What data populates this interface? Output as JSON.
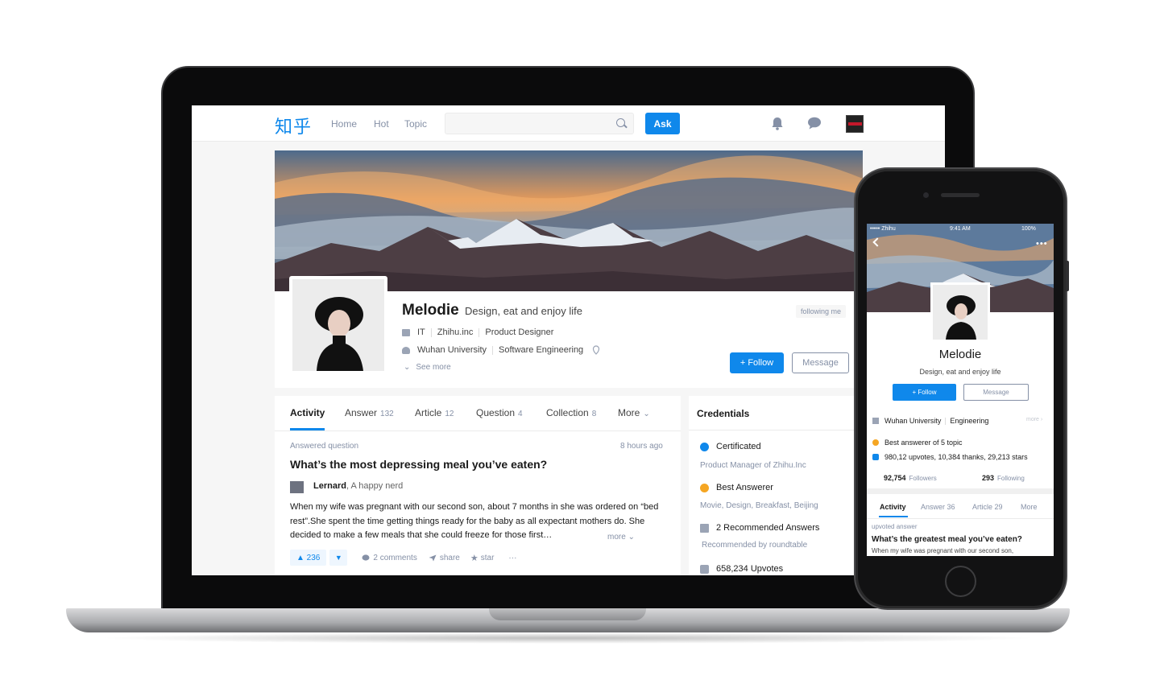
{
  "desktop": {
    "logo": "知乎",
    "nav": [
      "Home",
      "Hot",
      "Topic"
    ],
    "search_placeholder": "",
    "ask_label": "Ask",
    "profile": {
      "name": "Melodie",
      "headline": "Design, eat and enjoy life",
      "following_me": "following me",
      "industry": "IT",
      "company": "Zhihu.inc",
      "position": "Product Designer",
      "school": "Wuhan University",
      "major": "Software Engineering",
      "see_more": "See more",
      "follow_label": "+ Follow",
      "message_label": "Message"
    },
    "tabs": [
      {
        "label": "Activity",
        "count": ""
      },
      {
        "label": "Answer",
        "count": "132"
      },
      {
        "label": "Article",
        "count": "12"
      },
      {
        "label": "Question",
        "count": "4"
      },
      {
        "label": "Collection",
        "count": "8"
      },
      {
        "label": "More",
        "count": ""
      }
    ],
    "feed_item": {
      "label": "Answered question",
      "time": "8 hours ago",
      "title": "What’s the most depressing meal you’ve eaten?",
      "author_name": "Lernard",
      "author_bio": ", A happy nerd",
      "excerpt": "When my wife was pregnant with our second son, about 7 months in she was ordered on “bed rest”.She spent the time getting things ready for the baby as all expectant mothers do. She decided to make a few meals that she could freeze for those first…",
      "more": "more",
      "upvotes": "▲ 236",
      "downvote": "▼",
      "comments": "2 comments",
      "share": "share",
      "star": "star",
      "ellipsis": "···"
    },
    "credentials": {
      "title": "Credentials",
      "items": [
        {
          "label": "Certificated",
          "sub": "Product Manager of Zhihu.Inc"
        },
        {
          "label": "Best Answerer",
          "sub": "Movie, Design, Breakfast, Beijing"
        },
        {
          "label": "2 Recommended Answers",
          "sub": "Recommended by roundtable"
        },
        {
          "label": "658,234 Upvotes",
          "sub": ""
        }
      ]
    }
  },
  "mobile": {
    "status_carrier": "••••• Zhihu",
    "status_time": "9:41 AM",
    "status_battery": "100%",
    "menu_dots": "•••",
    "name": "Melodie",
    "headline": "Design, eat and enjoy life",
    "follow_label": "+ Follow",
    "message_label": "Message",
    "school": "Wuhan University",
    "major": "Engineering",
    "more": "more ›",
    "best_answerer": "Best answerer of 5 topic",
    "stats_line": "980,12 upvotes, 10,384 thanks, 29,213 stars",
    "followers_count": "92,754",
    "followers_label": "Followers",
    "following_count": "293",
    "following_label": "Following",
    "tabs": [
      "Activity",
      "Answer 36",
      "Article 29",
      "More"
    ],
    "feed_label": "upvoted answer",
    "feed_title": "What’s the greatest meal you’ve eaten?",
    "feed_excerpt": "When my wife was pregnant with our second son,"
  },
  "colors": {
    "accent": "#0f88eb",
    "muted": "#8590a6",
    "orange": "#f5a623"
  }
}
